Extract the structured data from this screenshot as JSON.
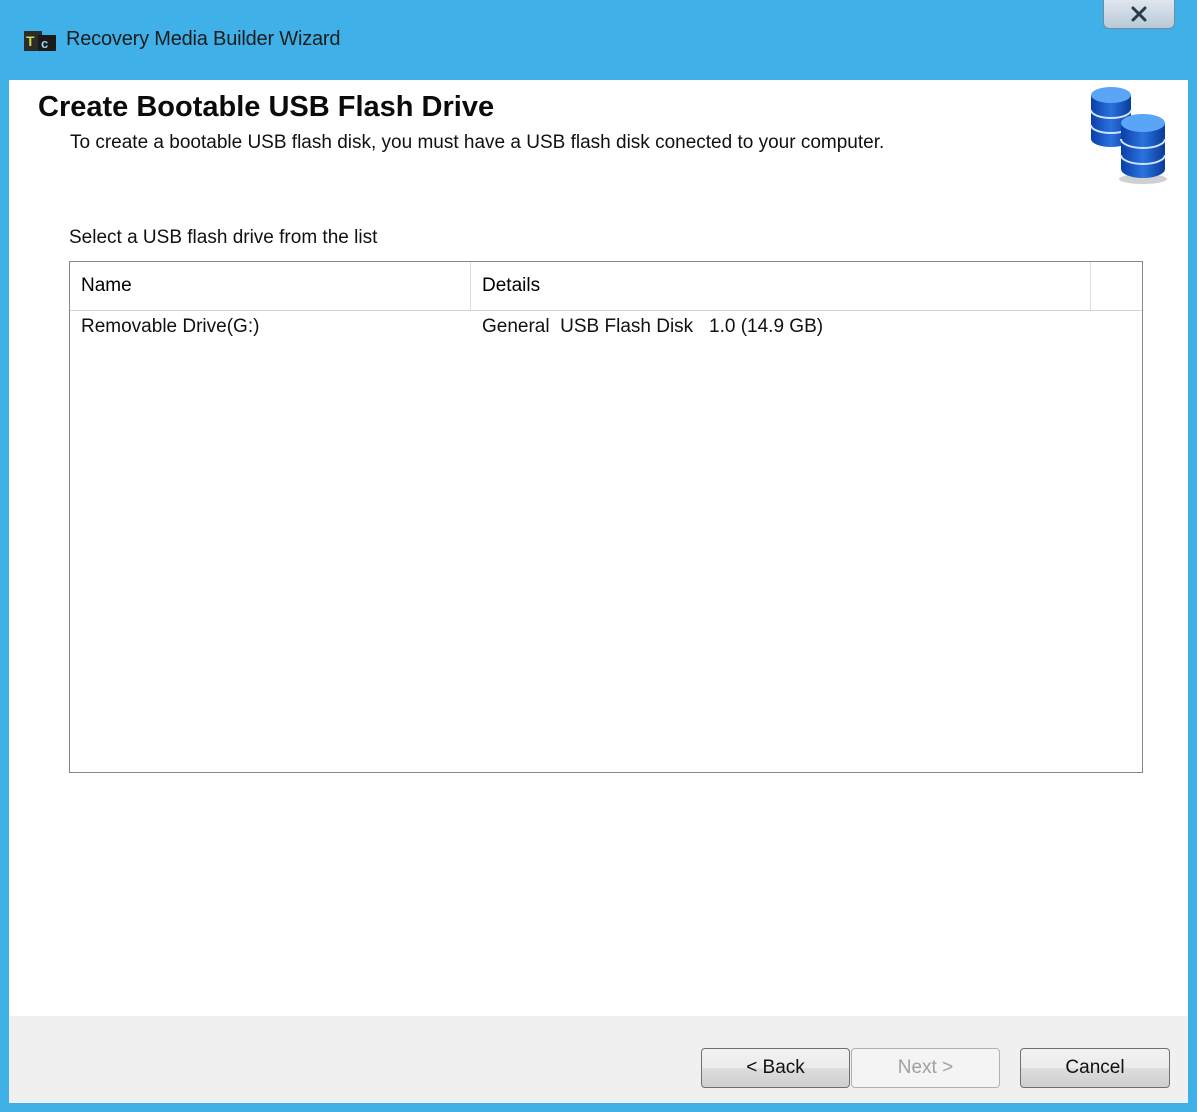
{
  "window": {
    "title": "Recovery Media Builder Wizard",
    "close_symbol": "✕",
    "app_icon": "app-logo-icon",
    "accent_color": "#3fb1e8"
  },
  "header": {
    "title": "Create Bootable USB Flash Drive",
    "subtitle": "To create a bootable USB flash disk, you must have a USB flash disk conected to your computer.",
    "icon": "database-icon"
  },
  "drive_list": {
    "label": "Select a USB flash drive from the list",
    "columns": [
      "Name",
      "Details",
      ""
    ],
    "rows": [
      {
        "name": "Removable Drive(G:)",
        "details": "General  USB Flash Disk   1.0 (14.9 GB)"
      }
    ]
  },
  "footer": {
    "back_label": "< Back",
    "next_label": "Next >",
    "cancel_label": "Cancel",
    "next_enabled": false
  }
}
